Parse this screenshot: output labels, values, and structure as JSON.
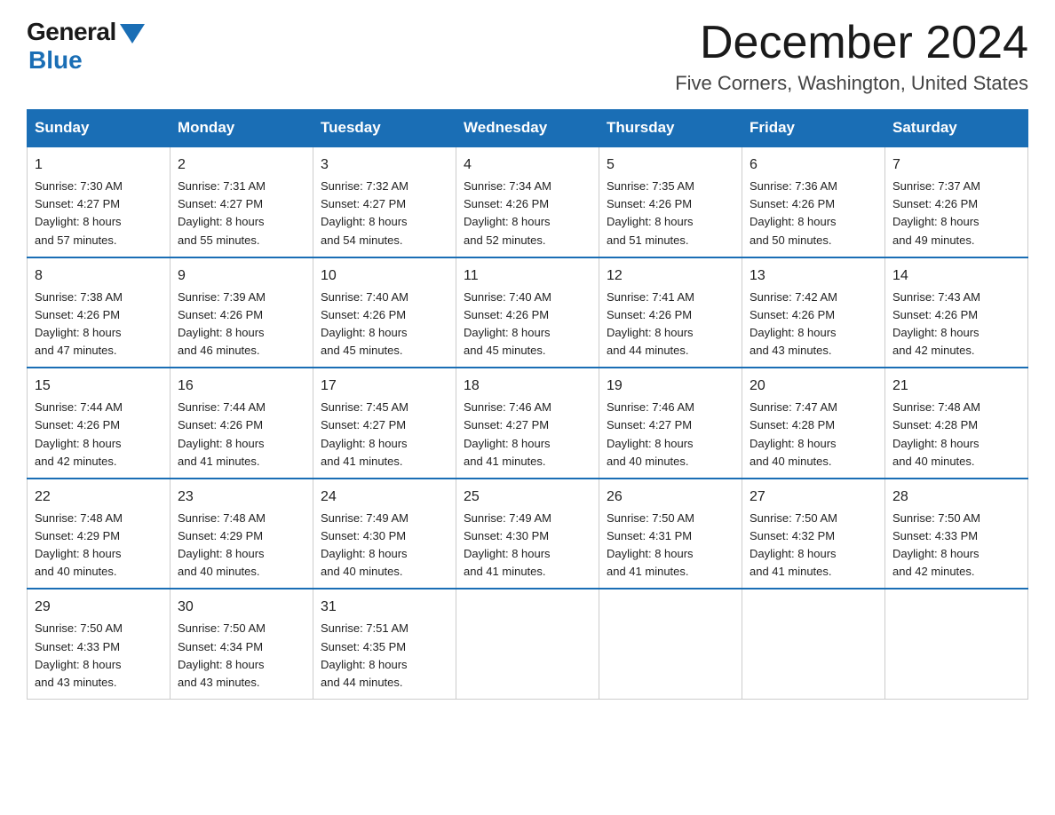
{
  "header": {
    "logo_general": "General",
    "logo_blue": "Blue",
    "month_title": "December 2024",
    "location": "Five Corners, Washington, United States"
  },
  "days_of_week": [
    "Sunday",
    "Monday",
    "Tuesday",
    "Wednesday",
    "Thursday",
    "Friday",
    "Saturday"
  ],
  "weeks": [
    [
      {
        "day": "1",
        "sunrise": "7:30 AM",
        "sunset": "4:27 PM",
        "daylight": "8 hours and 57 minutes."
      },
      {
        "day": "2",
        "sunrise": "7:31 AM",
        "sunset": "4:27 PM",
        "daylight": "8 hours and 55 minutes."
      },
      {
        "day": "3",
        "sunrise": "7:32 AM",
        "sunset": "4:27 PM",
        "daylight": "8 hours and 54 minutes."
      },
      {
        "day": "4",
        "sunrise": "7:34 AM",
        "sunset": "4:26 PM",
        "daylight": "8 hours and 52 minutes."
      },
      {
        "day": "5",
        "sunrise": "7:35 AM",
        "sunset": "4:26 PM",
        "daylight": "8 hours and 51 minutes."
      },
      {
        "day": "6",
        "sunrise": "7:36 AM",
        "sunset": "4:26 PM",
        "daylight": "8 hours and 50 minutes."
      },
      {
        "day": "7",
        "sunrise": "7:37 AM",
        "sunset": "4:26 PM",
        "daylight": "8 hours and 49 minutes."
      }
    ],
    [
      {
        "day": "8",
        "sunrise": "7:38 AM",
        "sunset": "4:26 PM",
        "daylight": "8 hours and 47 minutes."
      },
      {
        "day": "9",
        "sunrise": "7:39 AM",
        "sunset": "4:26 PM",
        "daylight": "8 hours and 46 minutes."
      },
      {
        "day": "10",
        "sunrise": "7:40 AM",
        "sunset": "4:26 PM",
        "daylight": "8 hours and 45 minutes."
      },
      {
        "day": "11",
        "sunrise": "7:40 AM",
        "sunset": "4:26 PM",
        "daylight": "8 hours and 45 minutes."
      },
      {
        "day": "12",
        "sunrise": "7:41 AM",
        "sunset": "4:26 PM",
        "daylight": "8 hours and 44 minutes."
      },
      {
        "day": "13",
        "sunrise": "7:42 AM",
        "sunset": "4:26 PM",
        "daylight": "8 hours and 43 minutes."
      },
      {
        "day": "14",
        "sunrise": "7:43 AM",
        "sunset": "4:26 PM",
        "daylight": "8 hours and 42 minutes."
      }
    ],
    [
      {
        "day": "15",
        "sunrise": "7:44 AM",
        "sunset": "4:26 PM",
        "daylight": "8 hours and 42 minutes."
      },
      {
        "day": "16",
        "sunrise": "7:44 AM",
        "sunset": "4:26 PM",
        "daylight": "8 hours and 41 minutes."
      },
      {
        "day": "17",
        "sunrise": "7:45 AM",
        "sunset": "4:27 PM",
        "daylight": "8 hours and 41 minutes."
      },
      {
        "day": "18",
        "sunrise": "7:46 AM",
        "sunset": "4:27 PM",
        "daylight": "8 hours and 41 minutes."
      },
      {
        "day": "19",
        "sunrise": "7:46 AM",
        "sunset": "4:27 PM",
        "daylight": "8 hours and 40 minutes."
      },
      {
        "day": "20",
        "sunrise": "7:47 AM",
        "sunset": "4:28 PM",
        "daylight": "8 hours and 40 minutes."
      },
      {
        "day": "21",
        "sunrise": "7:48 AM",
        "sunset": "4:28 PM",
        "daylight": "8 hours and 40 minutes."
      }
    ],
    [
      {
        "day": "22",
        "sunrise": "7:48 AM",
        "sunset": "4:29 PM",
        "daylight": "8 hours and 40 minutes."
      },
      {
        "day": "23",
        "sunrise": "7:48 AM",
        "sunset": "4:29 PM",
        "daylight": "8 hours and 40 minutes."
      },
      {
        "day": "24",
        "sunrise": "7:49 AM",
        "sunset": "4:30 PM",
        "daylight": "8 hours and 40 minutes."
      },
      {
        "day": "25",
        "sunrise": "7:49 AM",
        "sunset": "4:30 PM",
        "daylight": "8 hours and 41 minutes."
      },
      {
        "day": "26",
        "sunrise": "7:50 AM",
        "sunset": "4:31 PM",
        "daylight": "8 hours and 41 minutes."
      },
      {
        "day": "27",
        "sunrise": "7:50 AM",
        "sunset": "4:32 PM",
        "daylight": "8 hours and 41 minutes."
      },
      {
        "day": "28",
        "sunrise": "7:50 AM",
        "sunset": "4:33 PM",
        "daylight": "8 hours and 42 minutes."
      }
    ],
    [
      {
        "day": "29",
        "sunrise": "7:50 AM",
        "sunset": "4:33 PM",
        "daylight": "8 hours and 43 minutes."
      },
      {
        "day": "30",
        "sunrise": "7:50 AM",
        "sunset": "4:34 PM",
        "daylight": "8 hours and 43 minutes."
      },
      {
        "day": "31",
        "sunrise": "7:51 AM",
        "sunset": "4:35 PM",
        "daylight": "8 hours and 44 minutes."
      },
      null,
      null,
      null,
      null
    ]
  ],
  "labels": {
    "sunrise": "Sunrise:",
    "sunset": "Sunset:",
    "daylight": "Daylight:"
  }
}
